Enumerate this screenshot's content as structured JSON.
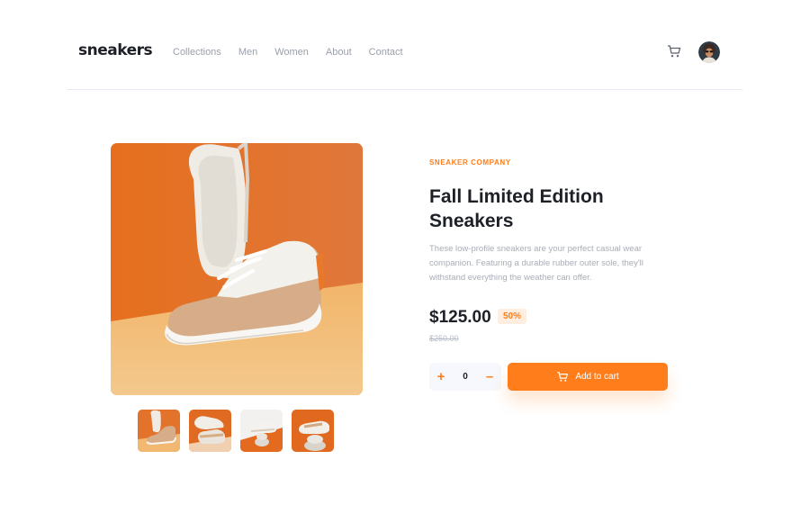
{
  "header": {
    "logo": "sneakers",
    "nav": [
      "Collections",
      "Men",
      "Women",
      "About",
      "Contact"
    ],
    "cart_icon": "cart-icon",
    "avatar_icon": "avatar"
  },
  "product": {
    "company": "SNEAKER COMPANY",
    "title": "Fall Limited Edition Sneakers",
    "description": "These low-profile sneakers are your perfect casual wear companion. Featuring a durable rubber outer sole, they'll withstand everything the weather can offer.",
    "price": "$125.00",
    "discount": "50%",
    "old_price": "$250.00",
    "quantity": "0",
    "plus_label": "+",
    "minus_label": "–",
    "add_to_cart": "Add to cart"
  },
  "gallery": {
    "thumbnails": [
      "product-1",
      "product-2",
      "product-3",
      "product-4"
    ],
    "selected": 0
  },
  "colors": {
    "accent": "#ff7e1b",
    "accent_pale": "#ffede0",
    "text_dark": "#1d2026",
    "text_muted": "#a8adb7"
  }
}
